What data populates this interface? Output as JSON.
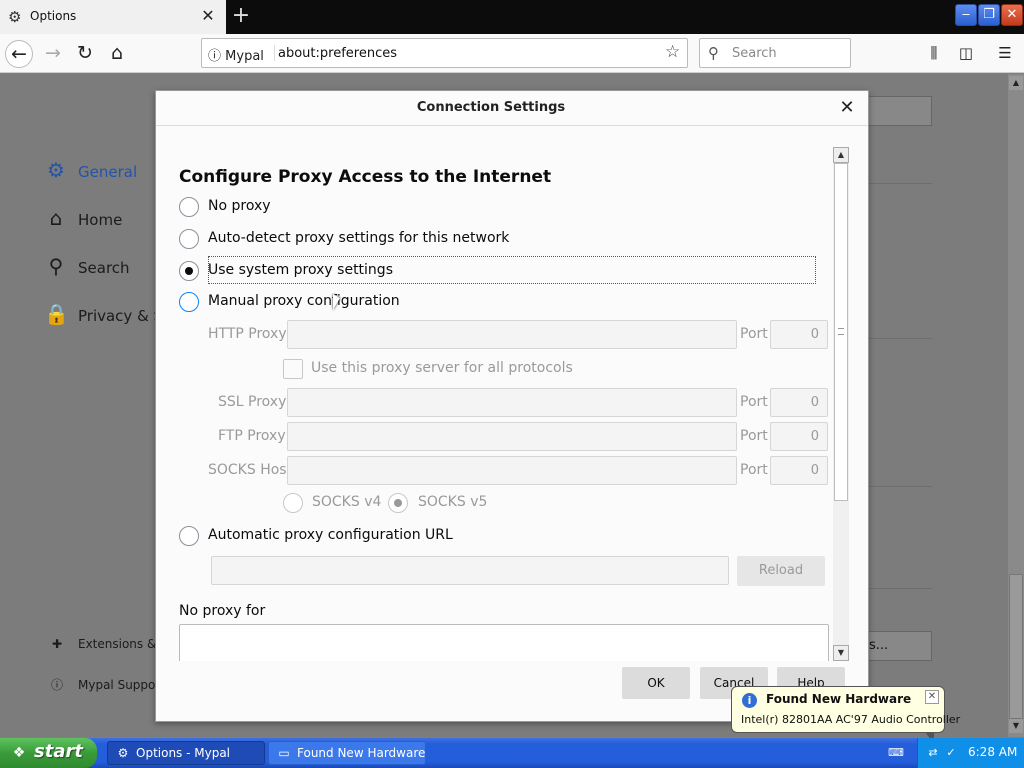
{
  "browser": {
    "tab_title": "Options",
    "tab_close": "✕",
    "new_tab": "+",
    "url_identity": "Mypal",
    "url": "about:preferences",
    "search_placeholder": "Search",
    "window_buttons": {
      "minimize": "‒",
      "restore": "❐",
      "close": "✕"
    }
  },
  "sidebar": {
    "items": [
      {
        "label": "General",
        "icon": "gear-icon",
        "active": true
      },
      {
        "label": "Home",
        "icon": "home-icon"
      },
      {
        "label": "Search",
        "icon": "search-icon"
      },
      {
        "label": "Privacy & Se",
        "icon": "lock-icon"
      }
    ],
    "footer": [
      {
        "label": "Extensions & T",
        "icon": "puzzle-icon"
      },
      {
        "label": "Mypal Support",
        "icon": "help-icon"
      }
    ],
    "bg_button": "s..."
  },
  "dialog": {
    "title": "Connection Settings",
    "close": "✕",
    "heading": "Configure Proxy Access to the Internet",
    "options": {
      "no_proxy": "No proxy",
      "auto_detect": "Auto-detect proxy settings for this network",
      "system": "Use system proxy settings",
      "manual": "Manual proxy configuration",
      "auto_url": "Automatic proxy configuration URL"
    },
    "selected_option": "system",
    "http_proxy_label": "HTTP Proxy",
    "ssl_proxy_label": "SSL Proxy",
    "ftp_proxy_label": "FTP Proxy",
    "socks_host_label": "SOCKS Host",
    "port_label": "Port",
    "http_port": "0",
    "ssl_port": "0",
    "ftp_port": "0",
    "socks_port": "0",
    "share_checkbox": "Use this proxy server for all protocols",
    "socks_v4": "SOCKS v4",
    "socks_v5": "SOCKS v5",
    "reload_button": "Reload",
    "no_proxy_for_label": "No proxy for",
    "ok_button": "OK",
    "cancel_button": "Cancel",
    "help_button": "Help"
  },
  "notification": {
    "title": "Found New Hardware",
    "text": "Intel(r) 82801AA AC'97 Audio Controller",
    "close": "✕"
  },
  "taskbar": {
    "start_label": "start",
    "buttons": [
      {
        "label": "Options - Mypal",
        "active": true
      },
      {
        "label": "Found New Hardware...",
        "active": false
      }
    ],
    "clock": "6:28 AM"
  }
}
